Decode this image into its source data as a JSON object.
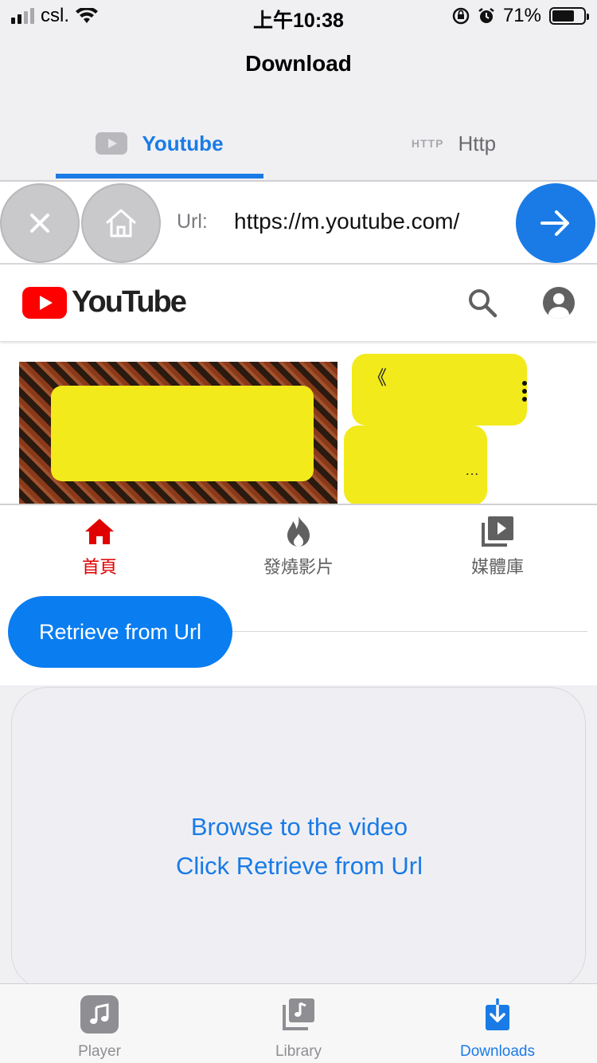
{
  "status_bar": {
    "carrier": "csl.",
    "time": "上午10:38",
    "battery_percent": "71%",
    "battery_level": 0.71
  },
  "nav": {
    "title": "Download"
  },
  "source_tabs": [
    {
      "label": "Youtube",
      "icon": "youtube-icon",
      "selected": true
    },
    {
      "label": "Http",
      "icon_text": "HTTP",
      "selected": false
    }
  ],
  "url_bar": {
    "label": "Url:",
    "value": "https://m.youtube.com/"
  },
  "webview": {
    "brand": "YouTube",
    "meta_quote": "《",
    "meta_ellipsis": "…",
    "bottom_nav": [
      {
        "label": "首頁",
        "icon": "home-icon",
        "active": true
      },
      {
        "label": "發燒影片",
        "icon": "trending-flame-icon",
        "active": false
      },
      {
        "label": "媒體庫",
        "icon": "library-icon",
        "active": false
      }
    ]
  },
  "retrieve": {
    "button_label": "Retrieve from Url"
  },
  "info": {
    "line1": "Browse to the video",
    "line2": "Click Retrieve from Url"
  },
  "tab_bar": [
    {
      "label": "Player",
      "icon": "music-note-icon",
      "active": false
    },
    {
      "label": "Library",
      "icon": "music-library-icon",
      "active": false
    },
    {
      "label": "Downloads",
      "icon": "download-icon",
      "active": true
    }
  ],
  "colors": {
    "accent": "#1a7be6",
    "retrieve_button": "#0a7df0",
    "youtube_red": "#ff0000",
    "active_nav_red": "#e00000"
  }
}
